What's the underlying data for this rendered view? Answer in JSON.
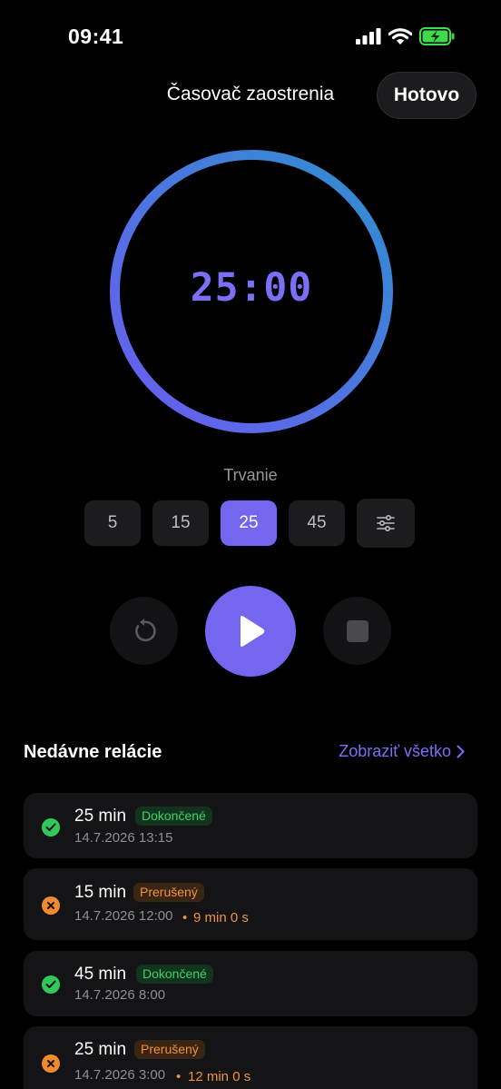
{
  "status_bar": {
    "time": "09:41"
  },
  "nav": {
    "title": "Časovač zaostrenia",
    "done_label": "Hotovo"
  },
  "timer": {
    "display": "25:00",
    "progress": 1.0,
    "ring_colors": [
      "#6a5cf0",
      "#2f8fd0"
    ]
  },
  "duration": {
    "label": "Trvanie",
    "options": [
      "5",
      "15",
      "25",
      "45"
    ],
    "selected": "25"
  },
  "controls": {
    "reset_icon": "reset-icon",
    "play_icon": "play-icon",
    "stop_icon": "stop-icon"
  },
  "recent": {
    "title": "Nedávne relácie",
    "see_all": "Zobraziť všetko",
    "sessions": [
      {
        "duration": "25 min",
        "status": "Dokončené",
        "state": "completed",
        "date": "14.7.2026 13:15",
        "extra": ""
      },
      {
        "duration": "15 min",
        "status": "Prerušený",
        "state": "interrupted",
        "date": "14.7.2026 12:00",
        "extra": "9 min 0 s"
      },
      {
        "duration": "45 min",
        "status": "Dokončené",
        "state": "completed",
        "date": "14.7.2026 8:00",
        "extra": ""
      },
      {
        "duration": "25 min",
        "status": "Prerušený",
        "state": "interrupted",
        "date": "14.7.2026 3:00",
        "extra": "12 min 0 s"
      }
    ]
  },
  "colors": {
    "accent": "#7466ee",
    "success": "#30c85a",
    "warning": "#ef8a2e"
  }
}
